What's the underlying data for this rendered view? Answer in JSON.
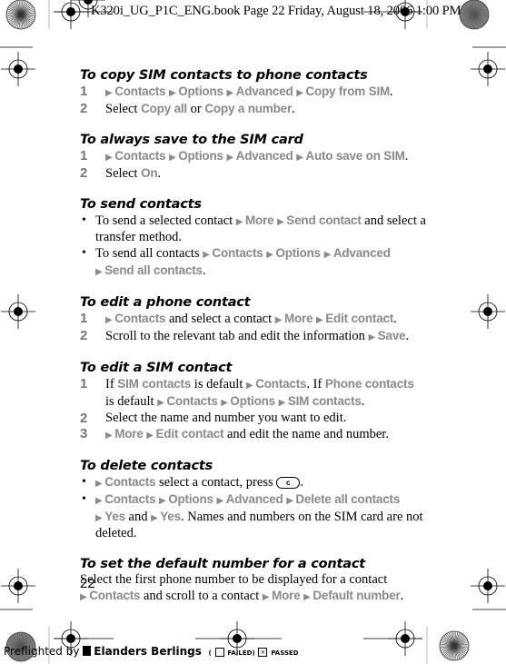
{
  "slug": "K320i_UG_P1C_ENG.book  Page 22  Friday, August 18, 2006  1:00 PM",
  "colors": {
    "menu_gray": "#8a8a8a",
    "step_number": "#777777",
    "text": "#000000"
  },
  "sections": [
    {
      "heading": "To copy SIM contacts to phone contacts",
      "steps": [
        {
          "n": "1",
          "parts": [
            [
              "m",
              "Contacts"
            ],
            [
              "m",
              "Options"
            ],
            [
              "m",
              "Advanced"
            ],
            [
              "m",
              "Copy from SIM"
            ],
            [
              "t",
              "."
            ]
          ]
        },
        {
          "n": "2",
          "parts": [
            [
              "t",
              "Select "
            ],
            [
              "g",
              "Copy all"
            ],
            [
              "t",
              " or "
            ],
            [
              "g",
              "Copy a number"
            ],
            [
              "t",
              "."
            ]
          ]
        }
      ]
    },
    {
      "heading": "To always save to the SIM card",
      "steps": [
        {
          "n": "1",
          "parts": [
            [
              "m",
              "Contacts"
            ],
            [
              "m",
              "Options"
            ],
            [
              "m",
              "Advanced"
            ],
            [
              "m",
              "Auto save on SIM"
            ],
            [
              "t",
              "."
            ]
          ]
        },
        {
          "n": "2",
          "parts": [
            [
              "t",
              "Select "
            ],
            [
              "g",
              "On"
            ],
            [
              "t",
              "."
            ]
          ]
        }
      ]
    },
    {
      "heading": "To send contacts",
      "bullets": [
        {
          "parts": [
            [
              "t",
              "To send a selected contact "
            ],
            [
              "m",
              "More"
            ],
            [
              "m",
              "Send contact"
            ],
            [
              "t",
              " and select a transfer method."
            ]
          ]
        },
        {
          "parts": [
            [
              "t",
              "To send all contacts "
            ],
            [
              "m",
              "Contacts"
            ],
            [
              "m",
              "Options"
            ],
            [
              "m",
              "Advanced"
            ],
            [
              "br",
              ""
            ],
            [
              "m",
              "Send all contacts"
            ],
            [
              "t",
              "."
            ]
          ]
        }
      ]
    },
    {
      "heading": "To edit a phone contact",
      "steps": [
        {
          "n": "1",
          "parts": [
            [
              "m",
              "Contacts"
            ],
            [
              "t",
              " and select a contact "
            ],
            [
              "m",
              "More"
            ],
            [
              "m",
              "Edit contact"
            ],
            [
              "t",
              "."
            ]
          ]
        },
        {
          "n": "2",
          "parts": [
            [
              "t",
              "Scroll to the relevant tab and edit the information "
            ],
            [
              "m",
              "Save"
            ],
            [
              "t",
              "."
            ]
          ]
        }
      ]
    },
    {
      "heading": "To edit a SIM contact",
      "steps": [
        {
          "n": "1",
          "parts": [
            [
              "t",
              "If "
            ],
            [
              "g",
              "SIM contacts"
            ],
            [
              "t",
              " is default "
            ],
            [
              "m",
              "Contacts"
            ],
            [
              "t",
              ". If "
            ],
            [
              "g",
              "Phone contacts"
            ],
            [
              "br",
              ""
            ],
            [
              "t",
              "is default "
            ],
            [
              "m",
              "Contacts"
            ],
            [
              "m",
              "Options"
            ],
            [
              "m",
              "SIM contacts"
            ],
            [
              "t",
              "."
            ]
          ]
        },
        {
          "n": "2",
          "parts": [
            [
              "t",
              "Select the name and number you want to edit."
            ]
          ]
        },
        {
          "n": "3",
          "parts": [
            [
              "m",
              "More"
            ],
            [
              "m",
              "Edit contact"
            ],
            [
              "t",
              " and edit the name and number."
            ]
          ]
        }
      ]
    },
    {
      "heading": "To delete contacts",
      "bullets": [
        {
          "parts": [
            [
              "m",
              "Contacts"
            ],
            [
              "t",
              " select a contact, press "
            ],
            [
              "key",
              "c"
            ],
            [
              "t",
              "."
            ]
          ]
        },
        {
          "parts": [
            [
              "m",
              "Contacts"
            ],
            [
              "m",
              "Options"
            ],
            [
              "m",
              "Advanced"
            ],
            [
              "m",
              "Delete all contacts"
            ],
            [
              "br",
              ""
            ],
            [
              "m",
              "Yes"
            ],
            [
              "t",
              " and "
            ],
            [
              "m",
              "Yes"
            ],
            [
              "t",
              ". Names and numbers on the SIM card are not deleted."
            ]
          ]
        }
      ]
    },
    {
      "heading": "To set the default number for a contact",
      "paragraph": [
        [
          "t",
          "Select the first phone number to be displayed for a contact "
        ],
        [
          "br",
          ""
        ],
        [
          "m",
          "Contacts"
        ],
        [
          "t",
          " and scroll to a contact "
        ],
        [
          "m",
          "More"
        ],
        [
          "m",
          "Default number"
        ],
        [
          "t",
          "."
        ]
      ]
    }
  ],
  "page_number": "22",
  "preflight": {
    "prefix": "Preflighted by",
    "company": "Elanders Berlings",
    "failed_label": "FAILED",
    "passed_label": "PASSED",
    "passed_checked": true
  },
  "icons": {
    "menu_arrow": "▶",
    "bullet": "•",
    "c_key": "c-key-icon"
  }
}
